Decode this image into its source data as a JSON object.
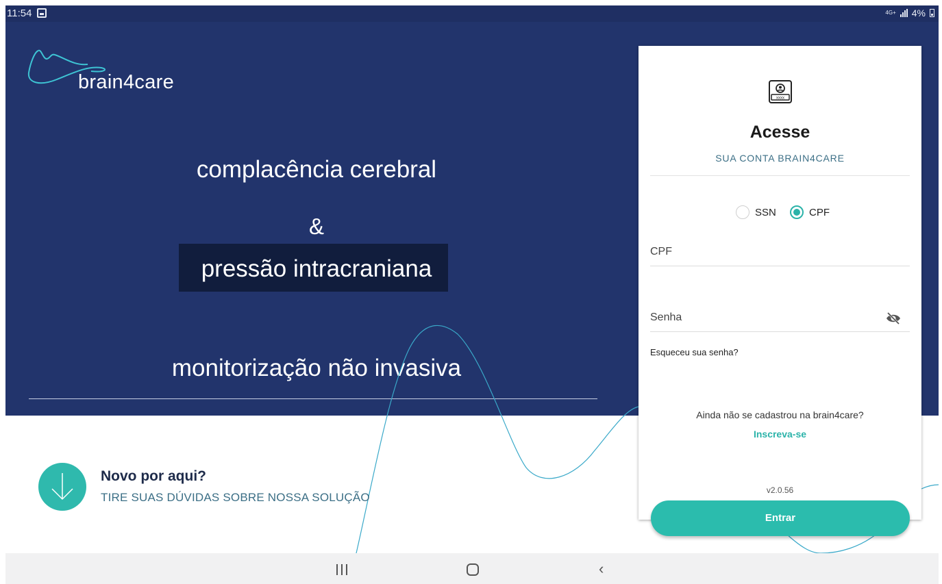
{
  "status_bar": {
    "time": "11:54",
    "network": "4G+",
    "battery": "4%"
  },
  "logo": {
    "text": "brain4care"
  },
  "hero": {
    "line1": "complacência cerebral",
    "line2": "&",
    "line3": "pressão intracraniana",
    "line4": "monitorização não invasiva"
  },
  "faq": {
    "title": "Novo por aqui?",
    "subtitle": "TIRE SUAS DÚVIDAS SOBRE NOSSA SOLUÇÃO"
  },
  "login": {
    "title": "Acesse",
    "subtitle": "SUA CONTA BRAIN4CARE",
    "id_options": [
      {
        "label": "SSN",
        "selected": false
      },
      {
        "label": "CPF",
        "selected": true
      }
    ],
    "cpf_placeholder": "CPF",
    "password_placeholder": "Senha",
    "forgot_password": "Esqueceu sua senha?",
    "signup_question": "Ainda não se cadastrou na brain4care?",
    "signup_link": "Inscreva-se",
    "version": "v2.0.56",
    "submit_label": "Entrar"
  },
  "colors": {
    "hero_background": "#22346c",
    "accent": "#2bbcad",
    "subtitle_text": "#3c6f86"
  },
  "icons": {
    "card": "id-card-icon",
    "password_toggle": "eye-off-icon",
    "faq": "arrow-down-icon"
  }
}
